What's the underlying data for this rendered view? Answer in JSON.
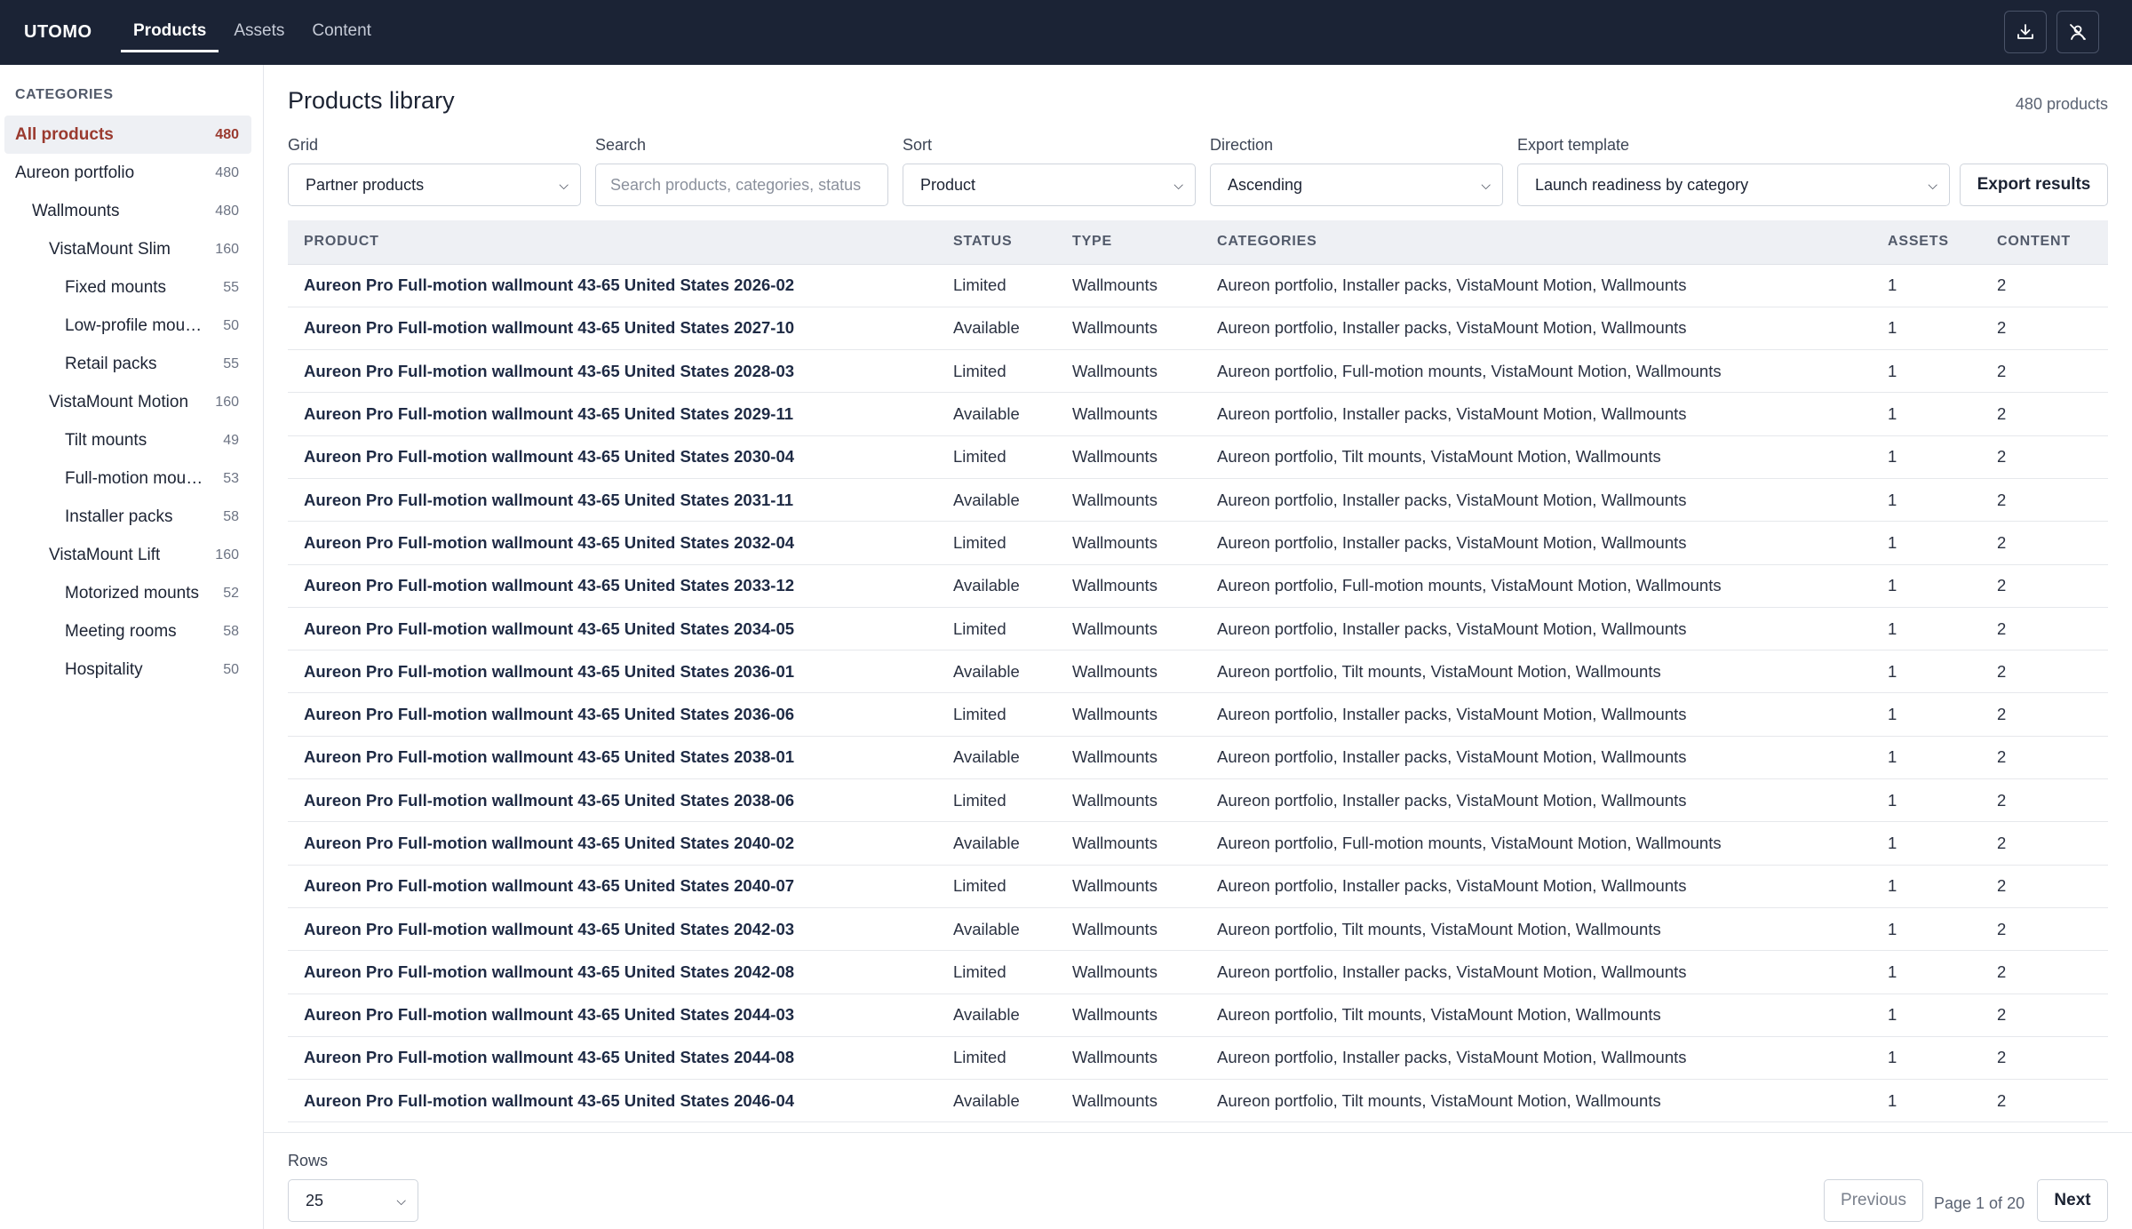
{
  "header": {
    "brand": "UTOMO",
    "tabs": [
      {
        "label": "Products"
      },
      {
        "label": "Assets"
      },
      {
        "label": "Content"
      }
    ]
  },
  "sidebar": {
    "heading": "CATEGORIES",
    "items": [
      {
        "label": "All products",
        "count": "480"
      },
      {
        "label": "Aureon portfolio",
        "count": "480"
      },
      {
        "label": "Wallmounts",
        "count": "480"
      },
      {
        "label": "VistaMount Slim",
        "count": "160"
      },
      {
        "label": "Fixed mounts",
        "count": "55"
      },
      {
        "label": "Low-profile mounts",
        "count": "50"
      },
      {
        "label": "Retail packs",
        "count": "55"
      },
      {
        "label": "VistaMount Motion",
        "count": "160"
      },
      {
        "label": "Tilt mounts",
        "count": "49"
      },
      {
        "label": "Full-motion mounts",
        "count": "53"
      },
      {
        "label": "Installer packs",
        "count": "58"
      },
      {
        "label": "VistaMount Lift",
        "count": "160"
      },
      {
        "label": "Motorized mounts",
        "count": "52"
      },
      {
        "label": "Meeting rooms",
        "count": "58"
      },
      {
        "label": "Hospitality",
        "count": "50"
      }
    ]
  },
  "main": {
    "title": "Products library",
    "product_count": "480 products",
    "filters": {
      "grid_label": "Grid",
      "grid_value": "Partner products",
      "search_label": "Search",
      "search_placeholder": "Search products, categories, status",
      "sort_label": "Sort",
      "sort_value": "Product",
      "direction_label": "Direction",
      "direction_value": "Ascending",
      "export_label": "Export template",
      "export_value": "Launch readiness by category",
      "export_button": "Export results"
    },
    "table": {
      "columns": [
        "PRODUCT",
        "STATUS",
        "TYPE",
        "CATEGORIES",
        "ASSETS",
        "CONTENT"
      ],
      "rows": [
        [
          "Aureon Pro Full-motion wallmount 43-65 United States 2026-02",
          "Limited",
          "Wallmounts",
          "Aureon portfolio, Installer packs, VistaMount Motion, Wallmounts",
          "1",
          "2"
        ],
        [
          "Aureon Pro Full-motion wallmount 43-65 United States 2027-10",
          "Available",
          "Wallmounts",
          "Aureon portfolio, Installer packs, VistaMount Motion, Wallmounts",
          "1",
          "2"
        ],
        [
          "Aureon Pro Full-motion wallmount 43-65 United States 2028-03",
          "Limited",
          "Wallmounts",
          "Aureon portfolio, Full-motion mounts, VistaMount Motion, Wallmounts",
          "1",
          "2"
        ],
        [
          "Aureon Pro Full-motion wallmount 43-65 United States 2029-11",
          "Available",
          "Wallmounts",
          "Aureon portfolio, Installer packs, VistaMount Motion, Wallmounts",
          "1",
          "2"
        ],
        [
          "Aureon Pro Full-motion wallmount 43-65 United States 2030-04",
          "Limited",
          "Wallmounts",
          "Aureon portfolio, Tilt mounts, VistaMount Motion, Wallmounts",
          "1",
          "2"
        ],
        [
          "Aureon Pro Full-motion wallmount 43-65 United States 2031-11",
          "Available",
          "Wallmounts",
          "Aureon portfolio, Installer packs, VistaMount Motion, Wallmounts",
          "1",
          "2"
        ],
        [
          "Aureon Pro Full-motion wallmount 43-65 United States 2032-04",
          "Limited",
          "Wallmounts",
          "Aureon portfolio, Installer packs, VistaMount Motion, Wallmounts",
          "1",
          "2"
        ],
        [
          "Aureon Pro Full-motion wallmount 43-65 United States 2033-12",
          "Available",
          "Wallmounts",
          "Aureon portfolio, Full-motion mounts, VistaMount Motion, Wallmounts",
          "1",
          "2"
        ],
        [
          "Aureon Pro Full-motion wallmount 43-65 United States 2034-05",
          "Limited",
          "Wallmounts",
          "Aureon portfolio, Installer packs, VistaMount Motion, Wallmounts",
          "1",
          "2"
        ],
        [
          "Aureon Pro Full-motion wallmount 43-65 United States 2036-01",
          "Available",
          "Wallmounts",
          "Aureon portfolio, Tilt mounts, VistaMount Motion, Wallmounts",
          "1",
          "2"
        ],
        [
          "Aureon Pro Full-motion wallmount 43-65 United States 2036-06",
          "Limited",
          "Wallmounts",
          "Aureon portfolio, Installer packs, VistaMount Motion, Wallmounts",
          "1",
          "2"
        ],
        [
          "Aureon Pro Full-motion wallmount 43-65 United States 2038-01",
          "Available",
          "Wallmounts",
          "Aureon portfolio, Installer packs, VistaMount Motion, Wallmounts",
          "1",
          "2"
        ],
        [
          "Aureon Pro Full-motion wallmount 43-65 United States 2038-06",
          "Limited",
          "Wallmounts",
          "Aureon portfolio, Installer packs, VistaMount Motion, Wallmounts",
          "1",
          "2"
        ],
        [
          "Aureon Pro Full-motion wallmount 43-65 United States 2040-02",
          "Available",
          "Wallmounts",
          "Aureon portfolio, Full-motion mounts, VistaMount Motion, Wallmounts",
          "1",
          "2"
        ],
        [
          "Aureon Pro Full-motion wallmount 43-65 United States 2040-07",
          "Limited",
          "Wallmounts",
          "Aureon portfolio, Installer packs, VistaMount Motion, Wallmounts",
          "1",
          "2"
        ],
        [
          "Aureon Pro Full-motion wallmount 43-65 United States 2042-03",
          "Available",
          "Wallmounts",
          "Aureon portfolio, Tilt mounts, VistaMount Motion, Wallmounts",
          "1",
          "2"
        ],
        [
          "Aureon Pro Full-motion wallmount 43-65 United States 2042-08",
          "Limited",
          "Wallmounts",
          "Aureon portfolio, Installer packs, VistaMount Motion, Wallmounts",
          "1",
          "2"
        ],
        [
          "Aureon Pro Full-motion wallmount 43-65 United States 2044-03",
          "Available",
          "Wallmounts",
          "Aureon portfolio, Tilt mounts, VistaMount Motion, Wallmounts",
          "1",
          "2"
        ],
        [
          "Aureon Pro Full-motion wallmount 43-65 United States 2044-08",
          "Limited",
          "Wallmounts",
          "Aureon portfolio, Installer packs, VistaMount Motion, Wallmounts",
          "1",
          "2"
        ],
        [
          "Aureon Pro Full-motion wallmount 43-65 United States 2046-04",
          "Available",
          "Wallmounts",
          "Aureon portfolio, Tilt mounts, VistaMount Motion, Wallmounts",
          "1",
          "2"
        ]
      ]
    },
    "footer": {
      "rows_label": "Rows",
      "rows_value": "25",
      "prev_button": "Previous",
      "page_text": "Page 1 of 20",
      "next_button": "Next"
    }
  },
  "icons": {
    "download": "download-icon",
    "user": "user-icon"
  },
  "colors": {
    "header_bg": "#1b2335",
    "accent_active": "#9a3a2f"
  }
}
